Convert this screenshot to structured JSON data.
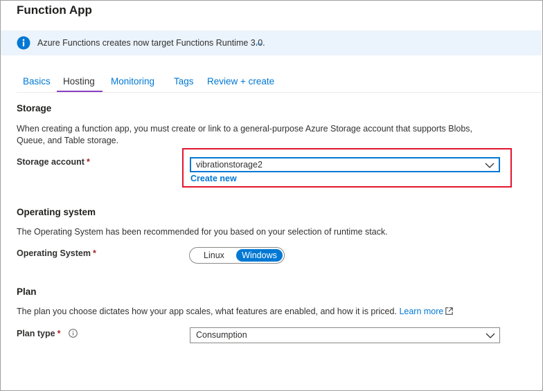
{
  "window": {
    "title": "Function App"
  },
  "banner": {
    "text": "Azure Functions creates now target Functions Runtime 3.0.",
    "arrow": "→",
    "icon": "info-icon"
  },
  "tabs": [
    {
      "label": "Basics",
      "active": false
    },
    {
      "label": "Hosting",
      "active": true
    },
    {
      "label": "Monitoring",
      "active": false
    },
    {
      "label": "Tags",
      "active": false
    },
    {
      "label": "Review + create",
      "active": false
    }
  ],
  "storage": {
    "title": "Storage",
    "description": "When creating a function app, you must create or link to a general-purpose Azure Storage account that supports Blobs, Queue, and Table storage.",
    "account_label": "Storage account",
    "required_mark": "*",
    "account_value": "vibrationstorage2",
    "create_new": "Create new"
  },
  "os": {
    "title": "Operating system",
    "description": "The Operating System has been recommended for you based on your selection of runtime stack.",
    "label": "Operating System",
    "required_mark": "*",
    "options": [
      "Linux",
      "Windows"
    ],
    "selected": "Windows"
  },
  "plan": {
    "title": "Plan",
    "description": "The plan you choose dictates how your app scales, what features are enabled, and how it is priced.",
    "learn_more": "Learn more",
    "label": "Plan type",
    "required_mark": "*",
    "value": "Consumption"
  },
  "colors": {
    "accent": "#0078d4",
    "banner_bg": "#ebf3fc",
    "active_tab_underline": "#8a3fc2",
    "highlight_border": "#e3152e",
    "required": "#a4262c"
  }
}
